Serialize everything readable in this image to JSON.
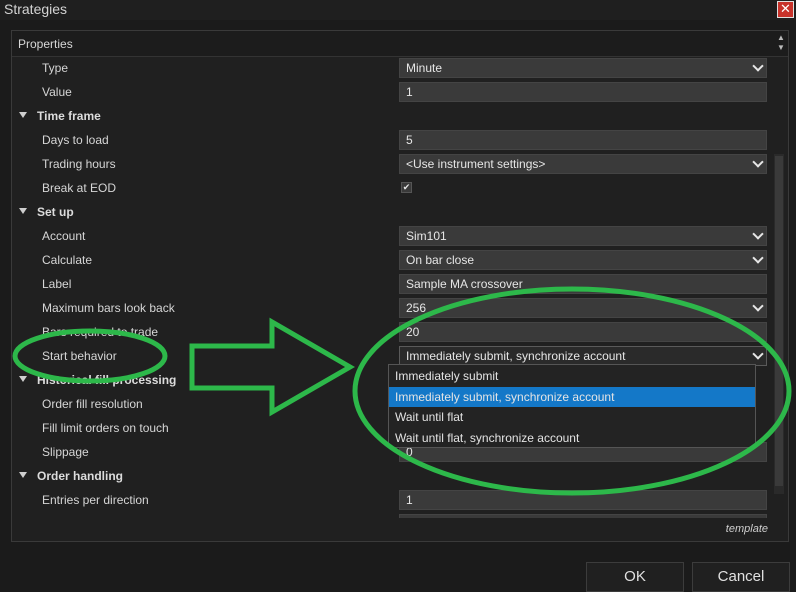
{
  "window": {
    "title": "Strategies",
    "close_glyph": "✕"
  },
  "panel": {
    "header": "Properties",
    "spin_up": "▲",
    "spin_down": "▼"
  },
  "rows": [
    {
      "kind": "prop",
      "label": "Type",
      "value": "Minute",
      "control": "select"
    },
    {
      "kind": "prop",
      "label": "Value",
      "value": "1",
      "control": "text"
    },
    {
      "kind": "cat",
      "label": "Time frame"
    },
    {
      "kind": "prop",
      "label": "Days to load",
      "value": "5",
      "control": "text"
    },
    {
      "kind": "prop",
      "label": "Trading hours",
      "value": "<Use instrument settings>",
      "control": "select"
    },
    {
      "kind": "prop",
      "label": "Break at EOD",
      "value": "✔",
      "control": "checkbox"
    },
    {
      "kind": "cat",
      "label": "Set up"
    },
    {
      "kind": "prop",
      "label": "Account",
      "value": "Sim101",
      "control": "select"
    },
    {
      "kind": "prop",
      "label": "Calculate",
      "value": "On bar close",
      "control": "select"
    },
    {
      "kind": "prop",
      "label": "Label",
      "value": "Sample MA crossover",
      "control": "text"
    },
    {
      "kind": "prop",
      "label": "Maximum bars look back",
      "value": "256",
      "control": "select"
    },
    {
      "kind": "prop",
      "label": "Bars required to trade",
      "value": "20",
      "control": "text"
    },
    {
      "kind": "prop",
      "label": "Start behavior",
      "value": "Immediately submit, synchronize account",
      "control": "select-open"
    },
    {
      "kind": "cat",
      "label": "Historical fill processing"
    },
    {
      "kind": "prop",
      "label": "Order fill resolution",
      "value": "",
      "control": "hidden"
    },
    {
      "kind": "prop",
      "label": "Fill limit orders on touch",
      "value": "",
      "control": "hidden"
    },
    {
      "kind": "prop",
      "label": "Slippage",
      "value": "0",
      "control": "text"
    },
    {
      "kind": "cat",
      "label": "Order handling"
    },
    {
      "kind": "prop",
      "label": "Entries per direction",
      "value": "1",
      "control": "text"
    },
    {
      "kind": "prop",
      "label": "",
      "value": "",
      "control": "text"
    }
  ],
  "dropdown": {
    "options": [
      "Immediately submit",
      "Immediately submit, synchronize account",
      "Wait until flat",
      "Wait until flat, synchronize account"
    ],
    "selected_index": 1
  },
  "template_label": "template",
  "buttons": {
    "ok": "OK",
    "cancel": "Cancel"
  },
  "colors": {
    "highlight": "#1478c8",
    "annotation": "#2db84a",
    "close": "#c8322a"
  }
}
